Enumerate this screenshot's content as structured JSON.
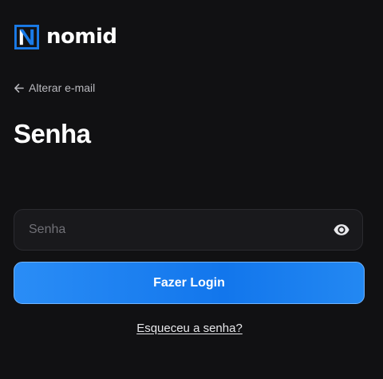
{
  "brand": {
    "name": "nomid",
    "accent_color": "#1a7be8",
    "logo_icon": "nomid-logo-icon"
  },
  "nav": {
    "back_label": "Alterar e-mail",
    "back_icon": "arrow-left-icon"
  },
  "page": {
    "title": "Senha"
  },
  "form": {
    "password": {
      "value": "",
      "placeholder": "Senha",
      "toggle_icon": "eye-icon"
    },
    "submit_label": "Fazer Login",
    "forgot_label": "Esqueceu a senha?"
  },
  "colors": {
    "background": "#111113",
    "input_background": "#19191c",
    "input_border": "#2b2b30",
    "button_primary": "#1276ec",
    "button_border": "#6fb4ff"
  }
}
